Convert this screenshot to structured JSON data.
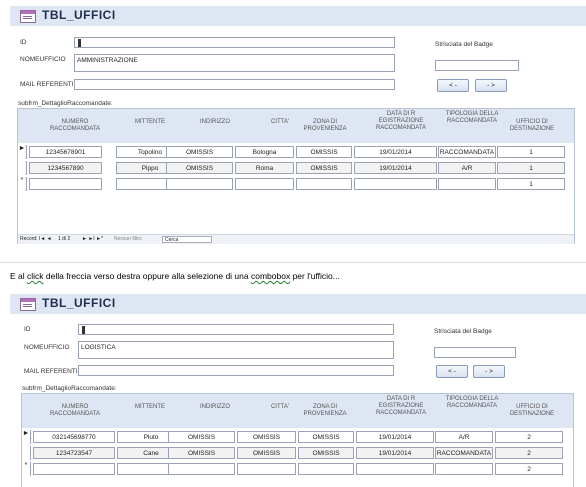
{
  "form1": {
    "title": "TBL_UFFICI",
    "labels": {
      "id": "ID",
      "nomeufficio": "NOMEUFFICIO",
      "mail": "MAIL REFERENTI",
      "badge": "Strisciata del Badge",
      "subform": "subfrm_DettaglioRaccomandate:"
    },
    "values": {
      "id": "",
      "nomeufficio": "AMMINISTRAZIONE",
      "mail": "",
      "badge": ""
    },
    "buttons": {
      "prev": "< -",
      "next": "- >"
    },
    "headers": [
      "NUMERO RACCOMANDATA",
      "MITTENTE",
      "INDIRIZZO",
      "CITTA'",
      "ZONA DI PROVENIENZA",
      "DATA DI R EGISTRAZIONE RACCOMANDATA",
      "TIPOLOGIA DELLA RACCOMANDATA",
      "UFFICIO DI DESTINAZIONE"
    ],
    "rows": [
      [
        "12345678901",
        "Topolino",
        "OMISSIS",
        "Bologna",
        "OMISSIS",
        "19/01/2014",
        "RACCOMANDATA",
        "1"
      ],
      [
        "1234567890",
        "Pippo",
        "OMISSIS",
        "Roma",
        "OMISSIS",
        "19/01/2014",
        "A/R",
        "1"
      ],
      [
        "",
        "",
        "",
        "",
        "",
        "",
        "",
        "1"
      ]
    ],
    "navbar": {
      "record": "Record: I◄ ◄",
      "pos": "1 di 2",
      "navbtns": "► ►I ►*",
      "filter": "Nessun filtro",
      "search": "Cerca"
    }
  },
  "caption": {
    "pre": "E al ",
    "click": "click",
    "mid1": " della freccia verso destra oppure alla selezione di una ",
    "combobox": "combobox",
    "post": " per l'ufficio..."
  },
  "form2": {
    "title": "TBL_UFFICI",
    "labels": {
      "id": "ID",
      "nomeufficio": "NOMEUFFICIO",
      "mail": "MAIL REFERENTI",
      "badge": "Strisciata del Badge",
      "subform": "subfrm_DettaglioRaccomandate:"
    },
    "values": {
      "id": "",
      "nomeufficio": "LOGISTICA",
      "mail": "",
      "badge": ""
    },
    "buttons": {
      "prev": "< -",
      "next": "- >"
    },
    "headers": [
      "NUMERO RACCOMANDATA",
      "MITTENTE",
      "INDIRIZZO",
      "CITTA'",
      "ZONA DI PROVENIENZA",
      "DATA DI R EGISTRAZIONE RACCOMANDATA",
      "TIPOLOGIA DELLA RACCOMANDATA",
      "UFFICIO DI DESTINAZIONE"
    ],
    "rows": [
      [
        "032145698770",
        "Pluto",
        "OMISSIS",
        "OMISSIS",
        "OMISSIS",
        "19/01/2014",
        "A/R",
        "2"
      ],
      [
        "1234723547",
        "Cane",
        "OMISSIS",
        "OMISSIS",
        "OMISSIS",
        "19/01/2014",
        "RACCOMANDATA",
        "2"
      ],
      [
        "",
        "",
        "",
        "",
        "",
        "",
        "",
        "2"
      ]
    ]
  }
}
